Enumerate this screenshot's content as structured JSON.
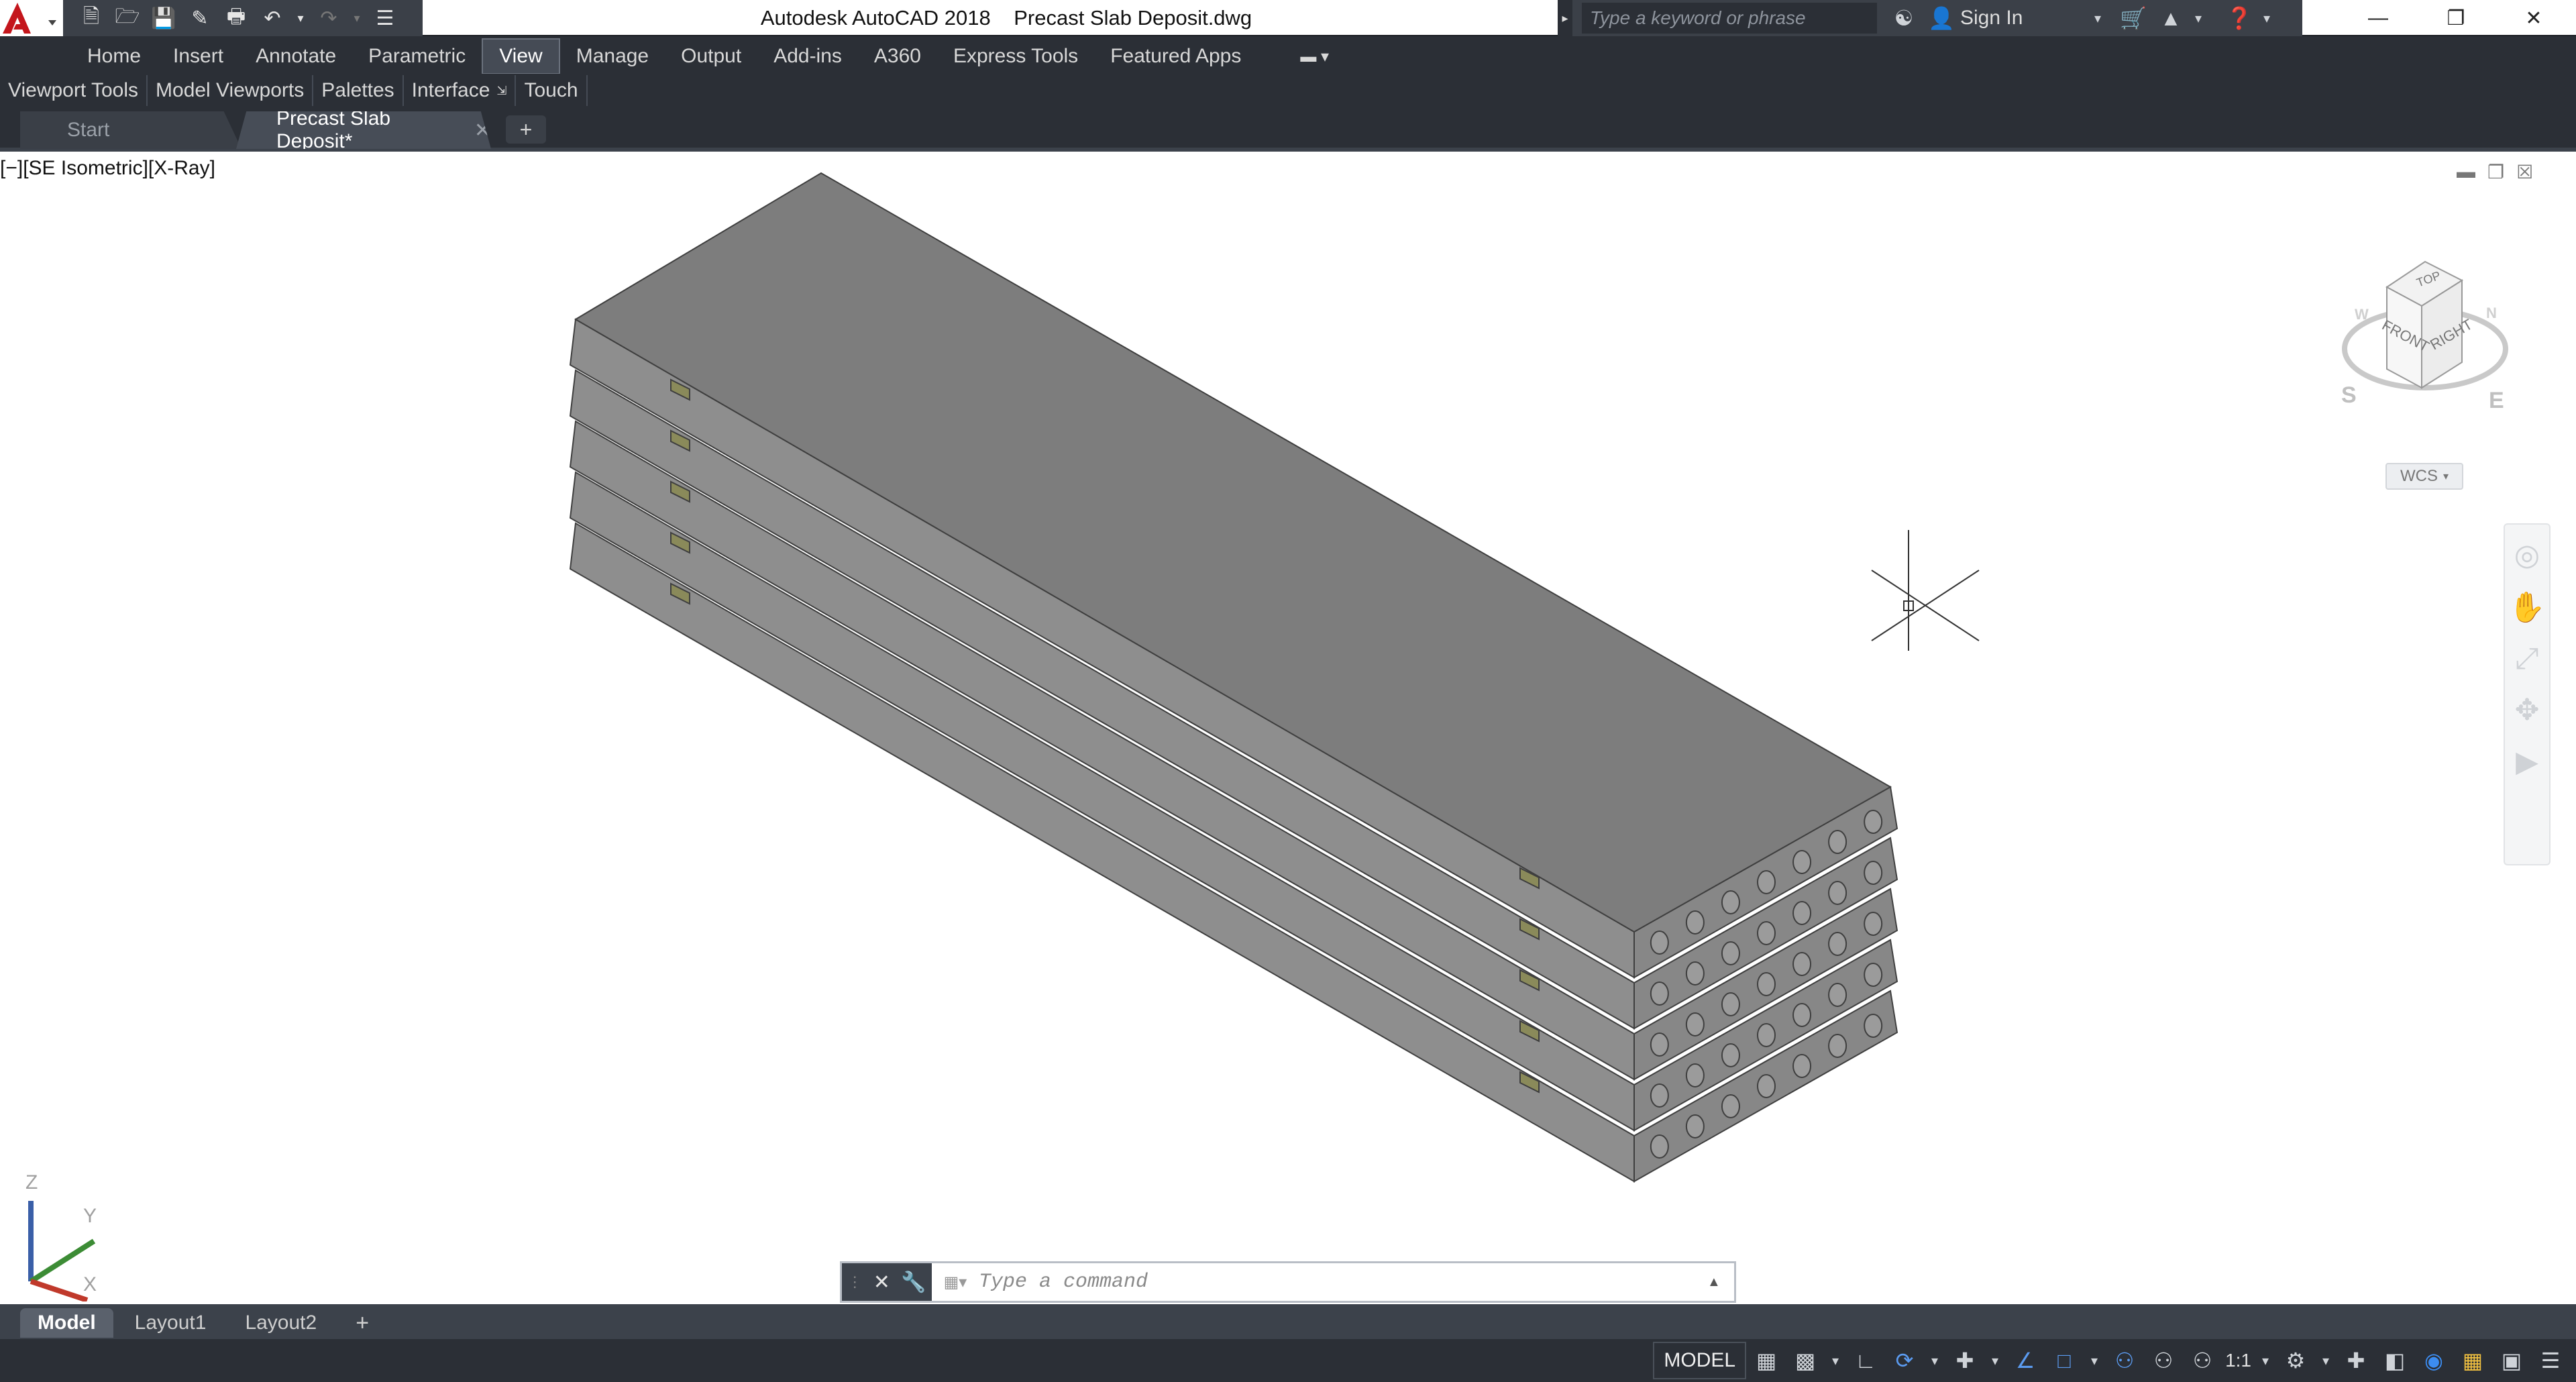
{
  "window": {
    "app_name": "Autodesk AutoCAD 2018",
    "document_name": "Precast Slab Deposit.dwg",
    "search_placeholder": "Type a keyword or phrase",
    "sign_in": "Sign In",
    "controls": [
      "minimize",
      "restore",
      "close"
    ]
  },
  "quick_access": [
    "new-icon",
    "open-icon",
    "save-icon",
    "save-as-icon",
    "plot-icon",
    "undo-icon",
    "redo-icon",
    "customize-icon"
  ],
  "ribbon": {
    "tabs": [
      "Home",
      "Insert",
      "Annotate",
      "Parametric",
      "View",
      "Manage",
      "Output",
      "Add-ins",
      "A360",
      "Express Tools",
      "Featured Apps"
    ],
    "active_tab": "View",
    "panels": [
      "Viewport Tools",
      "Model Viewports",
      "Palettes",
      "Interface",
      "Touch"
    ]
  },
  "doc_tabs": [
    {
      "label": "Start",
      "active": false
    },
    {
      "label": "Precast Slab Deposit*",
      "active": true
    }
  ],
  "viewport": {
    "label": "[−][SE Isometric][X-Ray]",
    "viewcube": {
      "top": "TOP",
      "front": "FRONT",
      "right": "RIGHT",
      "compass_s": "S",
      "compass_e": "E",
      "compass_w": "W",
      "compass_n": "N"
    },
    "ucs_menu": "WCS",
    "slab_count": 5,
    "cores_per_slab": 7,
    "ucs_axes": {
      "z": "Z",
      "y": "Y",
      "x": "X"
    }
  },
  "command": {
    "placeholder": "Type a command"
  },
  "layout_tabs": [
    {
      "label": "Model",
      "active": true
    },
    {
      "label": "Layout1",
      "active": false
    },
    {
      "label": "Layout2",
      "active": false
    }
  ],
  "status": {
    "space": "MODEL",
    "scale": "1:1"
  },
  "colors": {
    "dark_chrome": "#2b2f36",
    "slab_top": "#7d7d7d",
    "slab_side": "#8e8e8e",
    "brand_red": "#c4161c"
  }
}
